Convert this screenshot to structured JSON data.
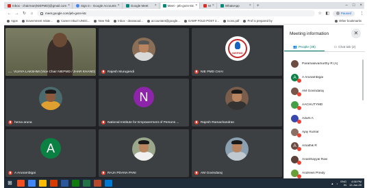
{
  "browser": {
    "tabs": [
      {
        "label": "Inbox - chairman(NIEPMD)@gmail.com",
        "active": false
      },
      {
        "label": "Sign in - Google Accounts",
        "active": false
      },
      {
        "label": "Google Meet",
        "active": false
      },
      {
        "label": "Meet - jeb-gxnn-ktc",
        "active": true
      },
      {
        "label": "M",
        "active": false
      },
      {
        "label": "WhatsApp",
        "active": false
      }
    ],
    "new_tab_glyph": "+",
    "url": "meet.google.com/jeb-gxnn-ktc",
    "paused_label": "Paused",
    "bookmarks": [
      "Apps",
      "Government relate...",
      "Career Inkuzl UNSC...",
      "New Tab",
      "Inbox - deanacad...",
      "accountant@google...",
      "GAMP FOLD POST 2...",
      "Icons.pdf",
      "Prof is prepared by"
    ],
    "other_bookmarks": "Other bookmarks"
  },
  "meet": {
    "tiles": [
      {
        "name": "VIJAYA LAKSHMI (Vice Chair NIEPMD / JHAR KHAND)",
        "kind": "video"
      },
      {
        "name": "Rajesh Murugendi",
        "kind": "photo"
      },
      {
        "name": "NIE PMD CHAI",
        "kind": "logo"
      },
      {
        "name": "hema aruna",
        "kind": "photo"
      },
      {
        "name": "National Institute for Empowerment of Persons ...",
        "kind": "letter",
        "letter": "N",
        "color": "#8e24aa"
      },
      {
        "name": "Rajesh Ramachandran",
        "kind": "photo"
      },
      {
        "name": "A Arunambigai",
        "kind": "letter",
        "letter": "A",
        "color": "#0b8043"
      },
      {
        "name": "RAJA PDANA PANI",
        "kind": "photo"
      },
      {
        "name": "AM Govindaraj",
        "kind": "photo"
      }
    ],
    "logo_text": "NIEPMD",
    "more_glyph": "..."
  },
  "panel": {
    "title": "Meeting information",
    "close_glyph": "✕",
    "tab_people": "People (35)",
    "tab_chat": "Chat tab (2)",
    "participants": [
      {
        "name": "Paramasivamurthy R (A)",
        "initial": "",
        "color": "#6d4c41"
      },
      {
        "name": "A Arunambigai",
        "initial": "A",
        "color": "#0b8043"
      },
      {
        "name": "AM Govindaraj",
        "initial": "",
        "color": "#795548"
      },
      {
        "name": "AACHUTYMD",
        "initial": "",
        "color": "#43a047"
      },
      {
        "name": "Adurti A",
        "initial": "",
        "color": "#3949ab"
      },
      {
        "name": "Ajay Kumar",
        "initial": "",
        "color": "#8d6e63"
      },
      {
        "name": "Amalhik R",
        "initial": "A",
        "color": "#6d4c41"
      },
      {
        "name": "Ananthayyal Ravi",
        "initial": "",
        "color": "#5d4037"
      },
      {
        "name": "Andrews Preidy",
        "initial": "",
        "color": "#689f38"
      }
    ]
  },
  "taskbar": {
    "lang": "ENG",
    "region": "IN",
    "time": "4:58 PM",
    "date": "12-Jun-20",
    "app_colors": [
      "#f25022",
      "#4285f4",
      "#fbbc05",
      "#d83b01",
      "#2b579a",
      "#107c10",
      "#217346",
      "#b7472a",
      "#0078d4"
    ]
  },
  "colors": {
    "meet_bg": "#202124",
    "tile_bg": "#3c4043",
    "accent": "#00796b",
    "mic_off": "#ea4335"
  }
}
